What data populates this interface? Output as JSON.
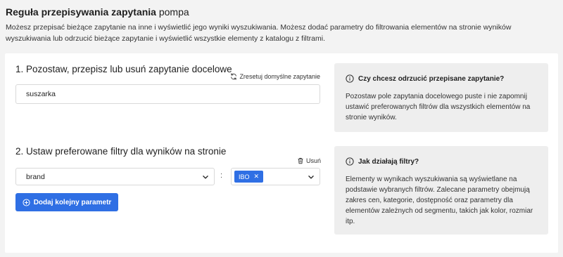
{
  "header": {
    "title_bold": "Reguła przepisywania zapytania",
    "title_name": "pompa",
    "description": "Możesz przepisać bieżące zapytanie na inne i wyświetlić jego wyniki wyszukiwania. Możesz dodać parametry do filtrowania elementów na stronie wyników wyszukiwania lub odrzucić bieżące zapytanie i wyświetlić wszystkie elementy z katalogu z filtrami."
  },
  "section1": {
    "title": "1. Pozostaw, przepisz lub usuń zapytanie docelowe",
    "reset_label": "Zresetuj domyślne zapytanie",
    "query_value": "suszarka",
    "info": {
      "title": "Czy chcesz odrzucić przepisane zapytanie?",
      "body": "Pozostaw pole zapytania docelowego puste i nie zapomnij ustawić preferowanych filtrów dla wszystkich elementów na stronie wyników."
    }
  },
  "section2": {
    "title": "2. Ustaw preferowane filtry dla wyników na stronie",
    "remove_label": "Usuń",
    "param_select": "brand",
    "separator": ":",
    "value_tags": [
      "IBO"
    ],
    "add_button": "Dodaj kolejny parametr",
    "info": {
      "title": "Jak działają filtry?",
      "body": "Elementy w wynikach wyszukiwania są wyświetlane na podstawie wybranych filtrów. Zalecane parametry obejmują zakres cen, kategorie, dostępność oraz parametry dla elementów zależnych od segmentu, takich jak kolor, rozmiar itp."
    }
  },
  "icons": {
    "reset": "refresh-icon",
    "info": "info-circle-icon",
    "remove": "trash-icon",
    "dropdown": "chevron-down-icon",
    "tag_remove": "close-icon",
    "add": "plus-circle-icon"
  },
  "colors": {
    "accent": "#2f6fe4",
    "page_bg": "#f3f3f3",
    "card_bg": "#ffffff",
    "info_bg": "#eeeeee"
  }
}
